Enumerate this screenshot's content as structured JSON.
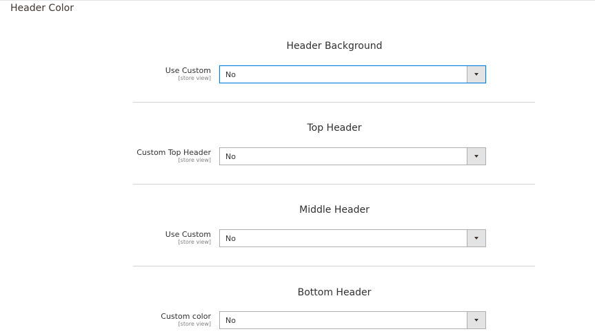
{
  "section": {
    "title": "Header Color"
  },
  "groups": [
    {
      "heading": "Header Background",
      "field_label": "Use Custom",
      "scope": "[store view]",
      "value": "No"
    },
    {
      "heading": "Top Header",
      "field_label": "Custom Top Header",
      "scope": "[store view]",
      "value": "No"
    },
    {
      "heading": "Middle Header",
      "field_label": "Use Custom",
      "scope": "[store view]",
      "value": "No"
    },
    {
      "heading": "Bottom Header",
      "field_label": "Custom color",
      "scope": "[store view]",
      "value": "No"
    }
  ],
  "icons": {
    "select_arrow": "chevron-down-icon"
  },
  "colors": {
    "focus_border": "#007bdb",
    "select_border": "#adadad",
    "arrow_bg": "#e3e3e3",
    "divider": "#d1d1d1"
  }
}
